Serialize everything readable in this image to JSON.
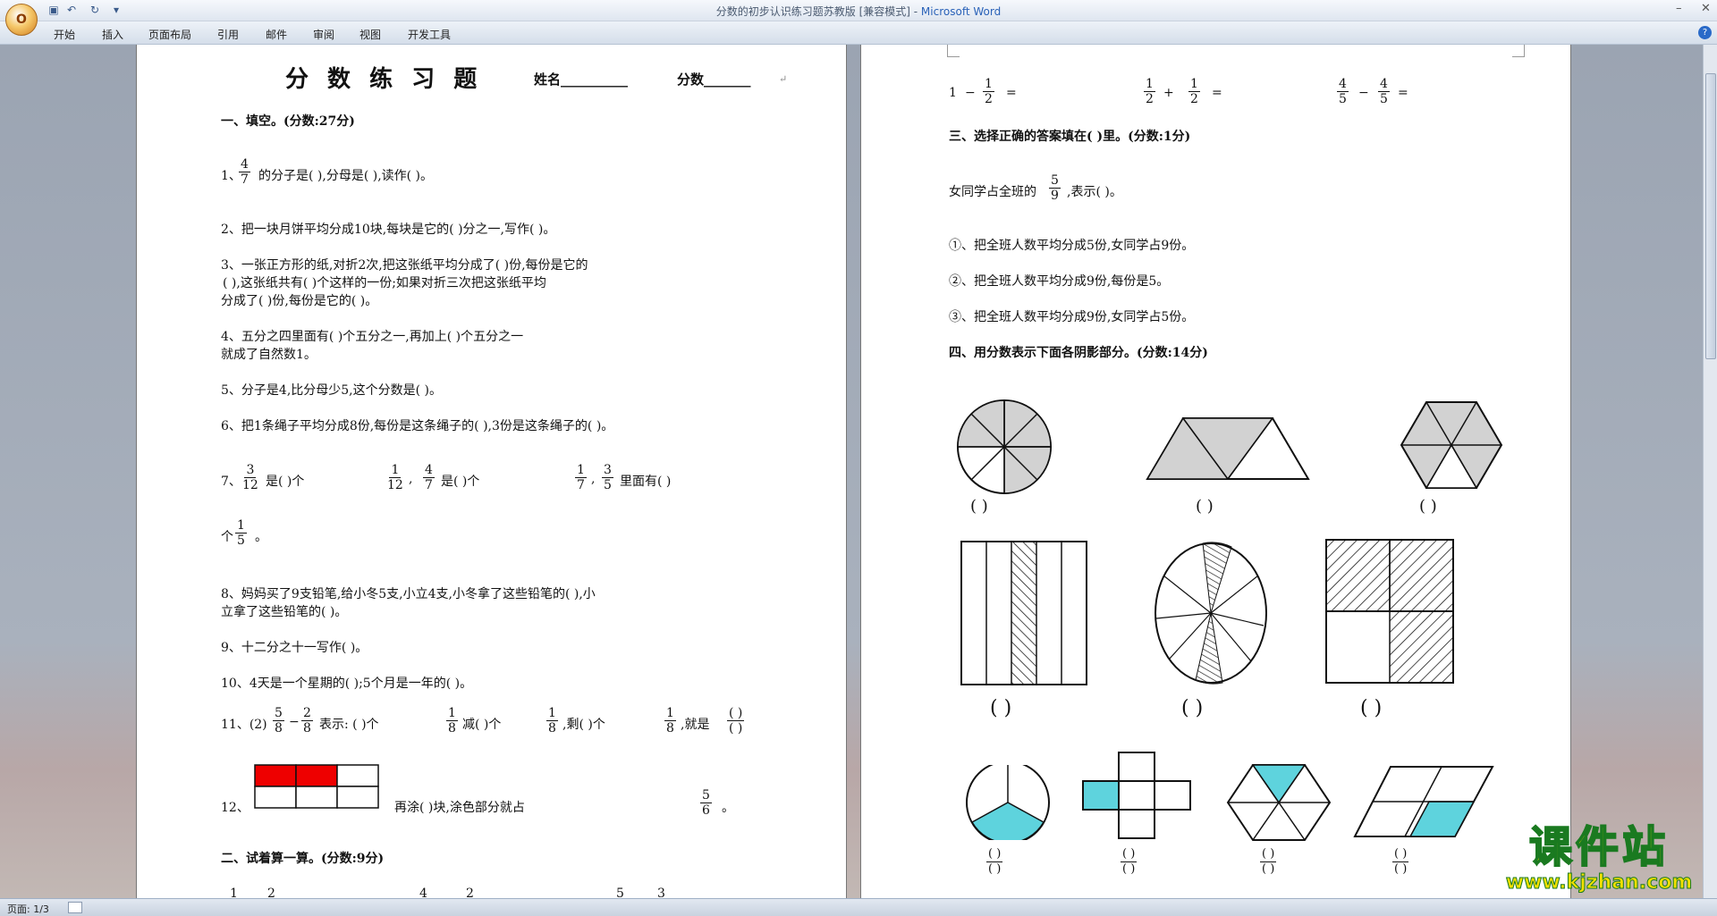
{
  "window": {
    "title": "分数的初步认识练习题苏教版 [兼容模式] - ",
    "app_name": "Microsoft Word",
    "office_button": "O",
    "quick_access": [
      "save-icon",
      "undo-icon",
      "redo-icon",
      "customize-icon"
    ]
  },
  "ribbon": {
    "tabs": [
      "开始",
      "插入",
      "页面布局",
      "引用",
      "邮件",
      "审阅",
      "视图",
      "开发工具"
    ]
  },
  "status": {
    "page": "页面: 1/3"
  },
  "watermark": {
    "main": "课件站",
    "url": "www.kjzhan.com"
  },
  "left_page": {
    "title": "分 数 练 习 题",
    "name_label": "姓名__________",
    "score_label": "分数_______",
    "section1": "一、填空。(分数:27分)",
    "q1": {
      "prefix": "1、",
      "num": "4",
      "den": "7",
      "text": "的分子是(          ),分母是(          ),读作(                              )。"
    },
    "q2": "2、把一块月饼平均分成10块,每块是它的(        )分之一,写作(              )。",
    "q3": [
      "3、一张正方形的纸,对折2次,把这张纸平均分成了(          )份,每份是它的",
      "(          ),这张纸共有(          )个这样的一份;如果对折三次把这张纸平均",
      "分成了(         )份,每份是它的(         )。"
    ],
    "q4": [
      "4、五分之四里面有(              )个五分之一,再加上(              )个五分之一",
      "就成了自然数1。"
    ],
    "q5": "5、分子是4,比分母少5,这个分数是(          )。",
    "q6": "6、把1条绳子平均分成8份,每份是这条绳子的(        ),3份是这条绳子的(          )。",
    "q7": {
      "prefix": "7、",
      "f1": {
        "num": "3",
        "den": "12"
      },
      "t1": "是(          )个",
      "f2": {
        "num": "1",
        "den": "12"
      },
      "t2": ",",
      "f3": {
        "num": "4",
        "den": "7"
      },
      "t3": "是(              )个",
      "f4": {
        "num": "1",
        "den": "7"
      },
      "t4": ",",
      "f5": {
        "num": "3",
        "den": "5"
      },
      "t5": "里面有(              )",
      "line2_prefix": "个",
      "f6": {
        "num": "1",
        "den": "5"
      },
      "line2_suffix": "。"
    },
    "q8": [
      "8、妈妈买了9支铅笔,给小冬5支,小立4支,小冬拿了这些铅笔的(          ),小",
      "立拿了这些铅笔的(          )。"
    ],
    "q9": "9、十二分之十一写作(                              )。",
    "q10": "10、4天是一个星期的(        );5个月是一年的(        )。",
    "q11": {
      "prefix": "11、(2)",
      "f1": {
        "num": "5",
        "den": "8"
      },
      "minus": "−",
      "f2": {
        "num": "2",
        "den": "8"
      },
      "t1": "表示:  (      )个",
      "f3": {
        "num": "1",
        "den": "8"
      },
      "t2": "减(      )个",
      "f4": {
        "num": "1",
        "den": "8"
      },
      "t3": ",剩(      )个",
      "f5": {
        "num": "1",
        "den": "8"
      },
      "t4": ",就是",
      "f6": {
        "num": "(  )",
        "den": "(  )"
      }
    },
    "q12": {
      "prefix": "12、",
      "text": "再涂(                        )块,涂色部分就占",
      "num": "5",
      "den": "6",
      "suffix": "。",
      "filled": 2,
      "total": 6
    },
    "section2": "二、试着算一算。(分数:9分)",
    "bottom_numbers": [
      "1",
      "2",
      "4",
      "2",
      "5",
      "3"
    ]
  },
  "right_page": {
    "calc": [
      {
        "a": "1",
        "op": "−",
        "num": "1",
        "den": "2",
        "eq": "="
      },
      {
        "num1": "1",
        "den1": "2",
        "op": "+",
        "num2": "1",
        "den2": "2",
        "eq": "="
      },
      {
        "num1": "4",
        "den1": "5",
        "op": "−",
        "num2": "4",
        "den2": "5",
        "eq": "="
      }
    ],
    "section3": "三、选择正确的答案填在(      )里。(分数:1分)",
    "q3_text": "女同学占全班的",
    "q3_num": "5",
    "q3_den": "9",
    "q3_suffix": ",表示(                        )。",
    "options": [
      "①、把全班人数平均分成5份,女同学占9份。",
      "②、把全班人数平均分成9份,每份是5。",
      "③、把全班人数平均分成9份,女同学占5份。"
    ],
    "section4": "四、用分数表示下面各阴影部分。(分数:14分)",
    "paren_small": "(       )",
    "paren_large": "(    )",
    "frac_blank_num": "(  )",
    "frac_blank_den": "(  )"
  }
}
